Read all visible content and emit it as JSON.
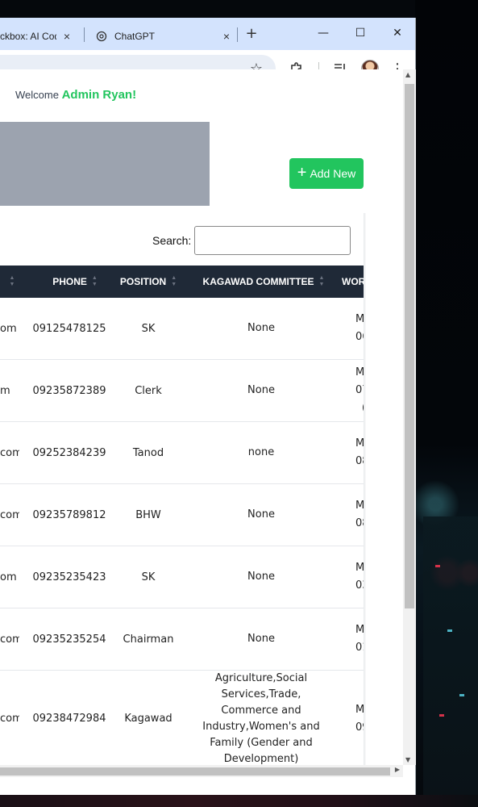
{
  "browser": {
    "tabs": [
      {
        "title": "ckbox: AI Cod",
        "close": "×"
      },
      {
        "title": "ChatGPT",
        "close": "×",
        "icon": "openai-icon"
      }
    ],
    "new_tab": "+",
    "window_controls": {
      "minimize": "—",
      "maximize": "☐",
      "close": "✕"
    },
    "toolbar_icons": [
      "star-icon",
      "extensions-icon",
      "media-icon",
      "avatar",
      "menu-icon"
    ]
  },
  "page": {
    "welcome_prefix": "Welcome",
    "welcome_user": "Admin Ryan!",
    "add_button": "Add New",
    "search_label": "Search:",
    "search_value": ""
  },
  "table": {
    "headers": {
      "phone": "PHONE",
      "position": "POSITION",
      "committee": "KAGAWAD COMMITTEE",
      "work": "WOR"
    },
    "rows": [
      {
        "email": "om",
        "phone": "09125478125",
        "position": "SK",
        "committee": "None",
        "work": [
          "M",
          "06"
        ]
      },
      {
        "email": "m",
        "phone": "09235872389",
        "position": "Clerk",
        "committee": "None",
        "work": [
          "M",
          "07:("
        ]
      },
      {
        "email": "com",
        "phone": "09252384239",
        "position": "Tanod",
        "committee": "none",
        "work": [
          "M",
          "08:"
        ]
      },
      {
        "email": "com",
        "phone": "09235789812",
        "position": "BHW",
        "committee": "None",
        "work": [
          "M",
          "08:"
        ]
      },
      {
        "email": "om",
        "phone": "09235235423",
        "position": "SK",
        "committee": "None",
        "work": [
          "M",
          "03:"
        ]
      },
      {
        "email": "com",
        "phone": "09235235254",
        "position": "Chairman",
        "committee": "None",
        "work": [
          "M",
          "01:"
        ]
      },
      {
        "email": "com",
        "phone": "09238472984",
        "position": "Kagawad",
        "committee": "Agriculture,Social Services,Trade, Commerce and Industry,Women's and Family (Gender and Development)",
        "work": [
          "M",
          "09"
        ]
      }
    ]
  },
  "colors": {
    "accent": "#22c55e",
    "table_header": "#1f2937",
    "tab_bar": "#d3e3fd",
    "placeholder_image": "#9ca3af"
  }
}
